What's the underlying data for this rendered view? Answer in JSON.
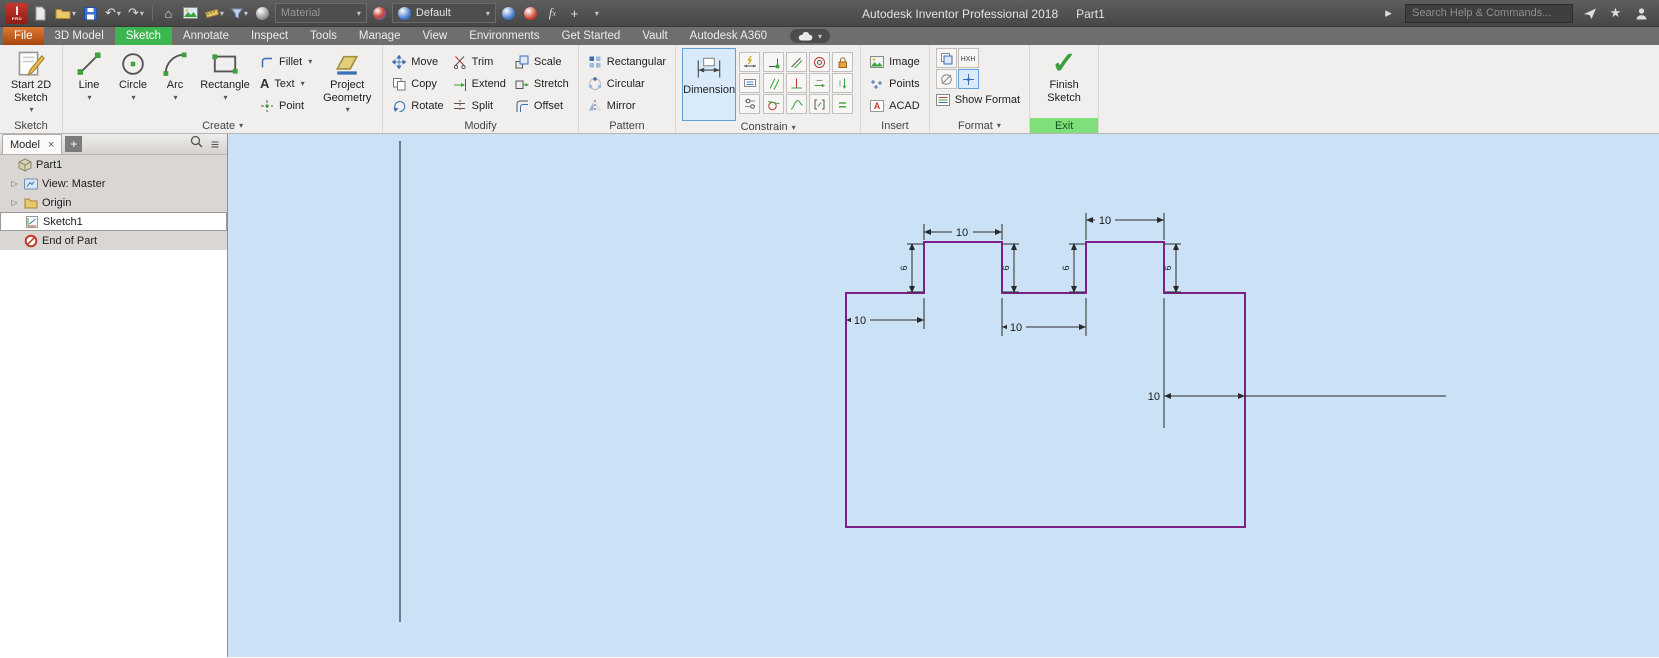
{
  "titlebar": {
    "app_title": "Autodesk Inventor Professional 2018",
    "doc_title": "Part1",
    "material_value": "Material",
    "appearance_value": "Default",
    "search_placeholder": "Search Help & Commands..."
  },
  "tabs": {
    "items": [
      "File",
      "3D Model",
      "Sketch",
      "Annotate",
      "Inspect",
      "Tools",
      "Manage",
      "View",
      "Environments",
      "Get Started",
      "Vault",
      "Autodesk A360"
    ]
  },
  "ribbon": {
    "groups": {
      "sketch": {
        "label": "Sketch",
        "start_2d_sketch": "Start 2D Sketch"
      },
      "create": {
        "label": "Create",
        "line": "Line",
        "circle": "Circle",
        "arc": "Arc",
        "rectangle": "Rectangle",
        "fillet": "Fillet",
        "text": "Text",
        "point": "Point",
        "project_geometry": "Project Geometry"
      },
      "modify": {
        "label": "Modify",
        "move": "Move",
        "copy": "Copy",
        "rotate": "Rotate",
        "trim": "Trim",
        "extend": "Extend",
        "split": "Split",
        "scale": "Scale",
        "stretch": "Stretch",
        "offset": "Offset"
      },
      "pattern": {
        "label": "Pattern",
        "rectangular": "Rectangular",
        "circular": "Circular",
        "mirror": "Mirror"
      },
      "constrain": {
        "label": "Constrain",
        "dimension": "Dimension"
      },
      "insert": {
        "label": "Insert",
        "image": "Image",
        "points": "Points",
        "acad": "ACAD"
      },
      "format": {
        "label": "Format",
        "show_format": "Show Format"
      },
      "exit": {
        "label": "Exit",
        "finish_sketch": "Finish Sketch"
      }
    }
  },
  "browser": {
    "tab_label": "Model",
    "tree": [
      {
        "label": "Part1"
      },
      {
        "label": "View: Master"
      },
      {
        "label": "Origin"
      },
      {
        "label": "Sketch1"
      },
      {
        "label": "End of Part"
      }
    ]
  },
  "sketch": {
    "dims": {
      "tab1_width": "10",
      "tab2_width": "10",
      "left_offset": "10",
      "middle_gap": "10",
      "right_offset": "10",
      "height1": "6",
      "height2": "6",
      "height3": "6",
      "height4": "6"
    }
  }
}
